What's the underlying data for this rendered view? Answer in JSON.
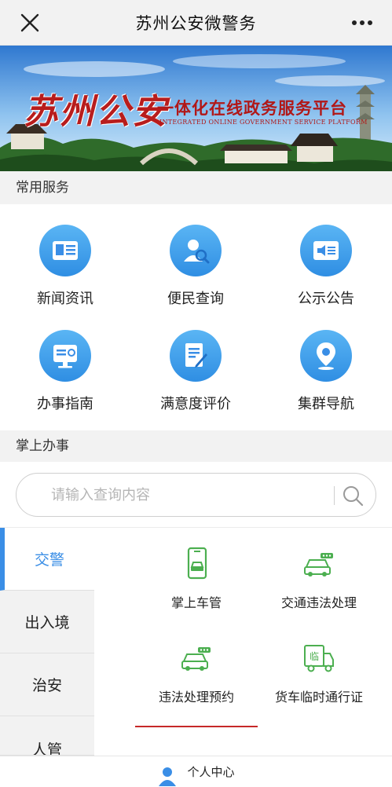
{
  "header": {
    "title": "苏州公安微警务",
    "close_icon": "close-icon",
    "more_icon": "more-icon"
  },
  "banner": {
    "brand": "苏州公安",
    "slogan": "一体化在线政务服务平台",
    "slogan_en": "INTEGRATED ONLINE GOVERNMENT SERVICE PLATFORM"
  },
  "common_services": {
    "title": "常用服务",
    "items": [
      {
        "label": "新闻资讯",
        "icon": "news-icon"
      },
      {
        "label": "便民查询",
        "icon": "user-search-icon"
      },
      {
        "label": "公示公告",
        "icon": "announcement-icon"
      },
      {
        "label": "办事指南",
        "icon": "guide-icon"
      },
      {
        "label": "满意度评价",
        "icon": "evaluation-icon"
      },
      {
        "label": "集群导航",
        "icon": "location-icon"
      }
    ]
  },
  "mobile_affairs": {
    "title": "掌上办事",
    "search": {
      "placeholder": "请输入查询内容",
      "value": ""
    },
    "categories": [
      {
        "label": "交警",
        "active": true
      },
      {
        "label": "出入境",
        "active": false
      },
      {
        "label": "治安",
        "active": false
      },
      {
        "label": "人管",
        "active": false
      }
    ],
    "functions": [
      {
        "label": "掌上车管",
        "icon": "mobile-car-icon"
      },
      {
        "label": "交通违法处理",
        "icon": "car-violation-icon"
      },
      {
        "label": "违法处理预约",
        "icon": "car-appointment-icon",
        "selected": true
      },
      {
        "label": "货车临时通行证",
        "icon": "truck-pass-icon"
      }
    ]
  },
  "bottom_nav": {
    "label": "个人中心",
    "icon": "user-icon"
  },
  "colors": {
    "accent": "#3a8ee6",
    "icon_green": "#4caf50",
    "brand_red": "#b81d1d",
    "underline": "#c62828"
  }
}
